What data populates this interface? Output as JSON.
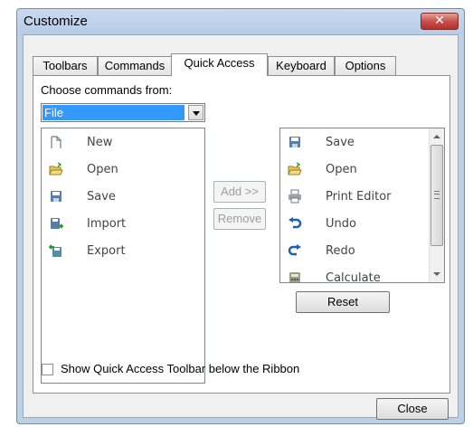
{
  "window": {
    "title": "Customize",
    "close_glyph": "✕"
  },
  "tabs": [
    {
      "label": "Toolbars"
    },
    {
      "label": "Commands"
    },
    {
      "label": "Quick Access"
    },
    {
      "label": "Keyboard"
    },
    {
      "label": "Options"
    }
  ],
  "active_tab": "Quick Access",
  "choose_label": "Choose commands from:",
  "combo": {
    "selected": "File"
  },
  "left_list": [
    {
      "label": "New",
      "icon": "new-document-icon"
    },
    {
      "label": "Open",
      "icon": "open-folder-icon"
    },
    {
      "label": "Save",
      "icon": "save-disk-icon"
    },
    {
      "label": "Import",
      "icon": "import-icon"
    },
    {
      "label": "Export",
      "icon": "export-icon"
    }
  ],
  "right_list": [
    {
      "label": "Save",
      "icon": "save-disk-icon"
    },
    {
      "label": "Open",
      "icon": "open-folder-icon"
    },
    {
      "label": "Print Editor",
      "icon": "printer-icon"
    },
    {
      "label": "Undo",
      "icon": "undo-icon"
    },
    {
      "label": "Redo",
      "icon": "redo-icon"
    },
    {
      "label": "Calculate",
      "icon": "calculate-icon"
    }
  ],
  "buttons": {
    "add": "Add >>",
    "remove": "Remove",
    "reset": "Reset",
    "close": "Close"
  },
  "checkbox": {
    "label": "Show Quick Access Toolbar below the Ribbon",
    "checked": false
  },
  "colors": {
    "selection": "#3399ff",
    "frame": "#bcd0e8",
    "close_button": "#c75050"
  }
}
